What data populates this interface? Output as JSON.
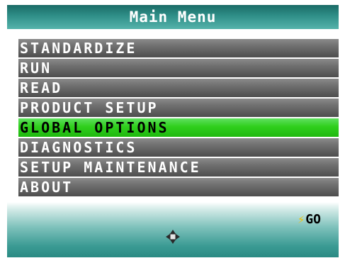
{
  "title": "Main Menu",
  "menu": {
    "items": [
      {
        "label": "STANDARDIZE"
      },
      {
        "label": "RUN"
      },
      {
        "label": "READ"
      },
      {
        "label": "PRODUCT SETUP"
      },
      {
        "label": "GLOBAL OPTIONS"
      },
      {
        "label": "DIAGNOSTICS"
      },
      {
        "label": "SETUP MAINTENANCE"
      },
      {
        "label": "ABOUT"
      }
    ],
    "selected_label": "GLOBAL OPTIONS"
  },
  "footer": {
    "go_label": "GO",
    "go_icon": "lightning-bolt-icon",
    "nav_icon": "four-way-dpad-icon"
  },
  "colors": {
    "title_bar": "#2f8f88",
    "menu_item": "#6e6e6e",
    "selected_item": "#2fcf1c",
    "footer": "#3a9a93",
    "bolt": "#f2c200"
  }
}
